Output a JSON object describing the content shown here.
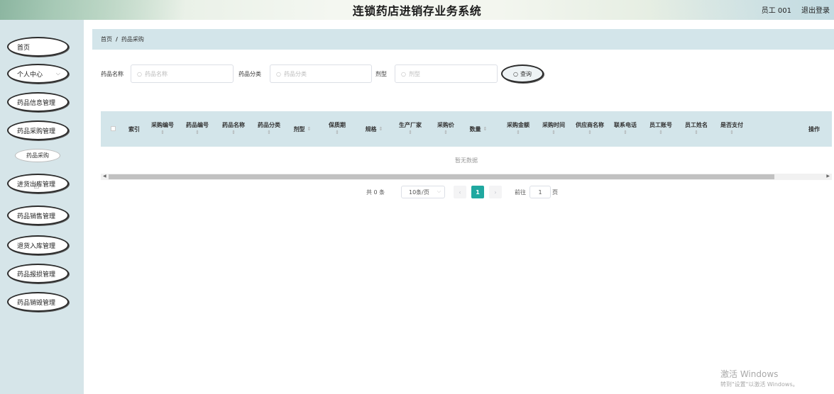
{
  "header": {
    "title": "连锁药店进销存业务系统",
    "user": "员工 001",
    "logout": "退出登录"
  },
  "sidebar": {
    "items": [
      {
        "label": "首页"
      },
      {
        "label": "个人中心"
      },
      {
        "label": "药品信息管理"
      },
      {
        "label": "药品采购管理"
      },
      {
        "label": "进货出库管理"
      },
      {
        "label": "药品销售管理"
      },
      {
        "label": "退货入库管理"
      },
      {
        "label": "药品报损管理"
      },
      {
        "label": "药品销毁管理"
      }
    ],
    "sub_item": "药品采购"
  },
  "breadcrumb": {
    "home": "首页",
    "separator": "/",
    "current": "药品采购"
  },
  "search": {
    "name_label": "药品名称",
    "name_placeholder": "药品名称",
    "category_label": "药品分类",
    "category_placeholder": "药品分类",
    "form_label": "剂型",
    "form_placeholder": "剂型",
    "button": "查询"
  },
  "table": {
    "columns": [
      {
        "label": "索引"
      },
      {
        "label": "采购编号"
      },
      {
        "label": "药品编号"
      },
      {
        "label": "药品名称"
      },
      {
        "label": "药品分类"
      },
      {
        "label": "剂型"
      },
      {
        "label": "保质期"
      },
      {
        "label": "规格"
      },
      {
        "label": "生产厂家"
      },
      {
        "label": "采购价"
      },
      {
        "label": "数量"
      },
      {
        "label": "采购金额"
      },
      {
        "label": "采购时间"
      },
      {
        "label": "供应商名称"
      },
      {
        "label": "联系电话"
      },
      {
        "label": "员工账号"
      },
      {
        "label": "员工姓名"
      },
      {
        "label": "是否支付"
      },
      {
        "label": "操作"
      }
    ],
    "empty_text": "暂无数据"
  },
  "pagination": {
    "total": "共 0 条",
    "page_size": "10条/页",
    "current_page": "1",
    "goto_label": "前往",
    "goto_value": "1",
    "page_unit": "页"
  },
  "watermark": {
    "line1": "激活 Windows",
    "line2": "转到\"设置\"以激活 Windows。"
  },
  "colors": {
    "sidebar_bg": "#d6e5e9",
    "header_row_bg": "#d3e5ea",
    "accent": "#20a8a0"
  }
}
